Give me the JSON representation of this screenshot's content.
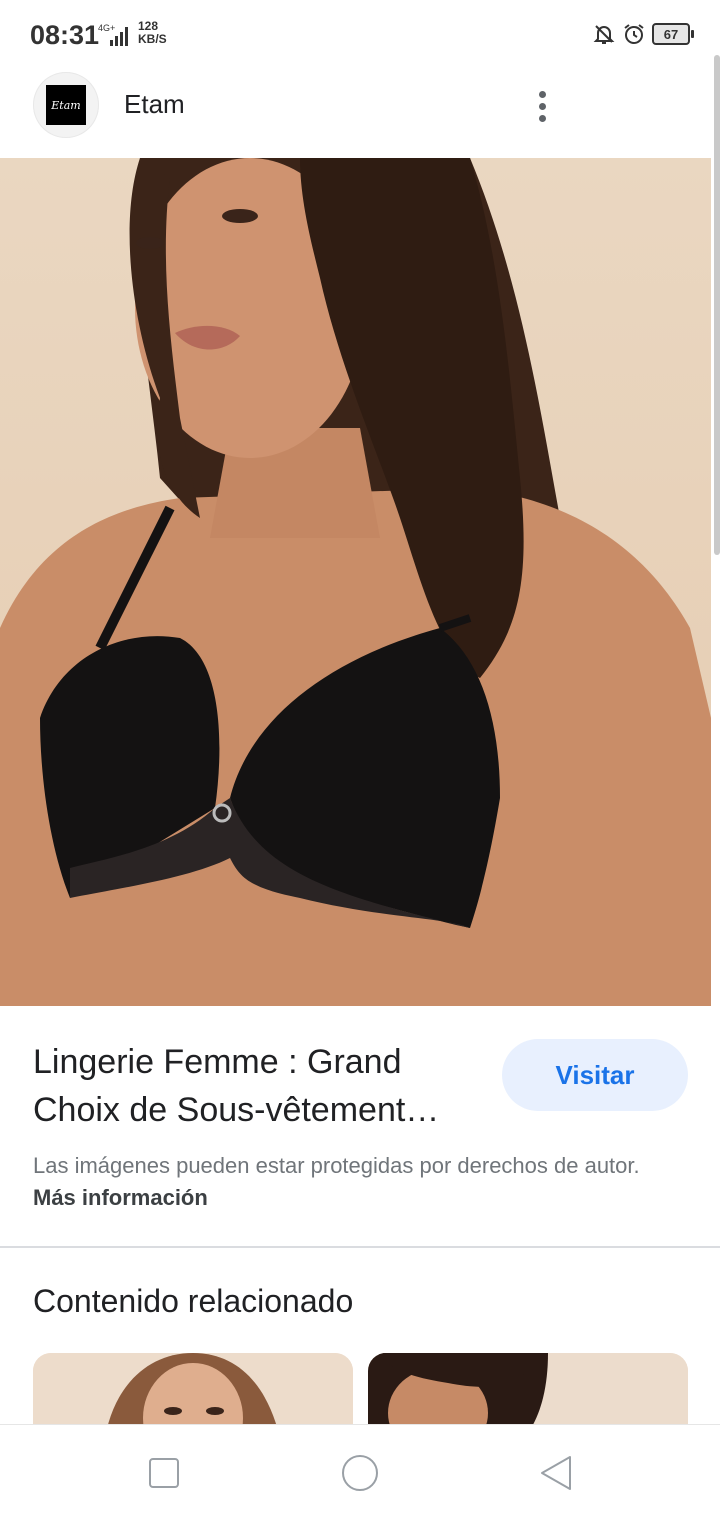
{
  "status_bar": {
    "time": "08:31",
    "network": "4G+",
    "speed_value": "128",
    "speed_unit": "KB/S",
    "battery": "67",
    "icons": [
      "signal-icon",
      "mute-bell-icon",
      "alarm-icon",
      "battery-icon"
    ]
  },
  "header": {
    "logo_text": "Etam",
    "site_name": "Etam",
    "menu_icon": "more-vert-icon"
  },
  "result": {
    "title": "Lingerie Femme : Grand Choix de Sous-vêtement…",
    "visit_label": "Visitar",
    "copyright_text": "Las imágenes pueden estar protegidas por derechos de autor.",
    "more_info_link": "Más información"
  },
  "related": {
    "title": "Contenido relacionado"
  },
  "nav": {
    "icons": [
      "recents-icon",
      "home-icon",
      "back-icon"
    ]
  }
}
